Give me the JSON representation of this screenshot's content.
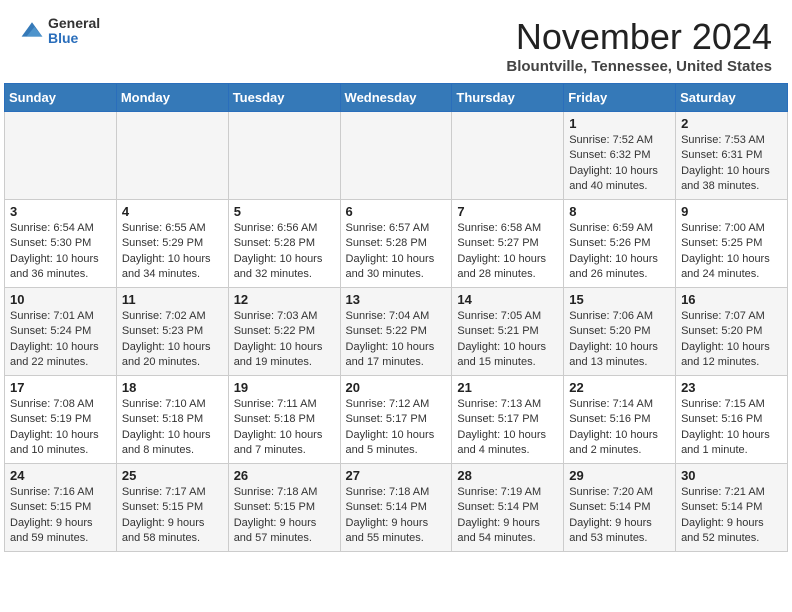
{
  "header": {
    "logo_general": "General",
    "logo_blue": "Blue",
    "month": "November 2024",
    "location": "Blountville, Tennessee, United States"
  },
  "weekdays": [
    "Sunday",
    "Monday",
    "Tuesday",
    "Wednesday",
    "Thursday",
    "Friday",
    "Saturday"
  ],
  "rows": [
    [
      {
        "day": "",
        "sunrise": "",
        "sunset": "",
        "daylight": ""
      },
      {
        "day": "",
        "sunrise": "",
        "sunset": "",
        "daylight": ""
      },
      {
        "day": "",
        "sunrise": "",
        "sunset": "",
        "daylight": ""
      },
      {
        "day": "",
        "sunrise": "",
        "sunset": "",
        "daylight": ""
      },
      {
        "day": "",
        "sunrise": "",
        "sunset": "",
        "daylight": ""
      },
      {
        "day": "1",
        "sunrise": "Sunrise: 7:52 AM",
        "sunset": "Sunset: 6:32 PM",
        "daylight": "Daylight: 10 hours and 40 minutes."
      },
      {
        "day": "2",
        "sunrise": "Sunrise: 7:53 AM",
        "sunset": "Sunset: 6:31 PM",
        "daylight": "Daylight: 10 hours and 38 minutes."
      }
    ],
    [
      {
        "day": "3",
        "sunrise": "Sunrise: 6:54 AM",
        "sunset": "Sunset: 5:30 PM",
        "daylight": "Daylight: 10 hours and 36 minutes."
      },
      {
        "day": "4",
        "sunrise": "Sunrise: 6:55 AM",
        "sunset": "Sunset: 5:29 PM",
        "daylight": "Daylight: 10 hours and 34 minutes."
      },
      {
        "day": "5",
        "sunrise": "Sunrise: 6:56 AM",
        "sunset": "Sunset: 5:28 PM",
        "daylight": "Daylight: 10 hours and 32 minutes."
      },
      {
        "day": "6",
        "sunrise": "Sunrise: 6:57 AM",
        "sunset": "Sunset: 5:28 PM",
        "daylight": "Daylight: 10 hours and 30 minutes."
      },
      {
        "day": "7",
        "sunrise": "Sunrise: 6:58 AM",
        "sunset": "Sunset: 5:27 PM",
        "daylight": "Daylight: 10 hours and 28 minutes."
      },
      {
        "day": "8",
        "sunrise": "Sunrise: 6:59 AM",
        "sunset": "Sunset: 5:26 PM",
        "daylight": "Daylight: 10 hours and 26 minutes."
      },
      {
        "day": "9",
        "sunrise": "Sunrise: 7:00 AM",
        "sunset": "Sunset: 5:25 PM",
        "daylight": "Daylight: 10 hours and 24 minutes."
      }
    ],
    [
      {
        "day": "10",
        "sunrise": "Sunrise: 7:01 AM",
        "sunset": "Sunset: 5:24 PM",
        "daylight": "Daylight: 10 hours and 22 minutes."
      },
      {
        "day": "11",
        "sunrise": "Sunrise: 7:02 AM",
        "sunset": "Sunset: 5:23 PM",
        "daylight": "Daylight: 10 hours and 20 minutes."
      },
      {
        "day": "12",
        "sunrise": "Sunrise: 7:03 AM",
        "sunset": "Sunset: 5:22 PM",
        "daylight": "Daylight: 10 hours and 19 minutes."
      },
      {
        "day": "13",
        "sunrise": "Sunrise: 7:04 AM",
        "sunset": "Sunset: 5:22 PM",
        "daylight": "Daylight: 10 hours and 17 minutes."
      },
      {
        "day": "14",
        "sunrise": "Sunrise: 7:05 AM",
        "sunset": "Sunset: 5:21 PM",
        "daylight": "Daylight: 10 hours and 15 minutes."
      },
      {
        "day": "15",
        "sunrise": "Sunrise: 7:06 AM",
        "sunset": "Sunset: 5:20 PM",
        "daylight": "Daylight: 10 hours and 13 minutes."
      },
      {
        "day": "16",
        "sunrise": "Sunrise: 7:07 AM",
        "sunset": "Sunset: 5:20 PM",
        "daylight": "Daylight: 10 hours and 12 minutes."
      }
    ],
    [
      {
        "day": "17",
        "sunrise": "Sunrise: 7:08 AM",
        "sunset": "Sunset: 5:19 PM",
        "daylight": "Daylight: 10 hours and 10 minutes."
      },
      {
        "day": "18",
        "sunrise": "Sunrise: 7:10 AM",
        "sunset": "Sunset: 5:18 PM",
        "daylight": "Daylight: 10 hours and 8 minutes."
      },
      {
        "day": "19",
        "sunrise": "Sunrise: 7:11 AM",
        "sunset": "Sunset: 5:18 PM",
        "daylight": "Daylight: 10 hours and 7 minutes."
      },
      {
        "day": "20",
        "sunrise": "Sunrise: 7:12 AM",
        "sunset": "Sunset: 5:17 PM",
        "daylight": "Daylight: 10 hours and 5 minutes."
      },
      {
        "day": "21",
        "sunrise": "Sunrise: 7:13 AM",
        "sunset": "Sunset: 5:17 PM",
        "daylight": "Daylight: 10 hours and 4 minutes."
      },
      {
        "day": "22",
        "sunrise": "Sunrise: 7:14 AM",
        "sunset": "Sunset: 5:16 PM",
        "daylight": "Daylight: 10 hours and 2 minutes."
      },
      {
        "day": "23",
        "sunrise": "Sunrise: 7:15 AM",
        "sunset": "Sunset: 5:16 PM",
        "daylight": "Daylight: 10 hours and 1 minute."
      }
    ],
    [
      {
        "day": "24",
        "sunrise": "Sunrise: 7:16 AM",
        "sunset": "Sunset: 5:15 PM",
        "daylight": "Daylight: 9 hours and 59 minutes."
      },
      {
        "day": "25",
        "sunrise": "Sunrise: 7:17 AM",
        "sunset": "Sunset: 5:15 PM",
        "daylight": "Daylight: 9 hours and 58 minutes."
      },
      {
        "day": "26",
        "sunrise": "Sunrise: 7:18 AM",
        "sunset": "Sunset: 5:15 PM",
        "daylight": "Daylight: 9 hours and 57 minutes."
      },
      {
        "day": "27",
        "sunrise": "Sunrise: 7:18 AM",
        "sunset": "Sunset: 5:14 PM",
        "daylight": "Daylight: 9 hours and 55 minutes."
      },
      {
        "day": "28",
        "sunrise": "Sunrise: 7:19 AM",
        "sunset": "Sunset: 5:14 PM",
        "daylight": "Daylight: 9 hours and 54 minutes."
      },
      {
        "day": "29",
        "sunrise": "Sunrise: 7:20 AM",
        "sunset": "Sunset: 5:14 PM",
        "daylight": "Daylight: 9 hours and 53 minutes."
      },
      {
        "day": "30",
        "sunrise": "Sunrise: 7:21 AM",
        "sunset": "Sunset: 5:14 PM",
        "daylight": "Daylight: 9 hours and 52 minutes."
      }
    ]
  ]
}
